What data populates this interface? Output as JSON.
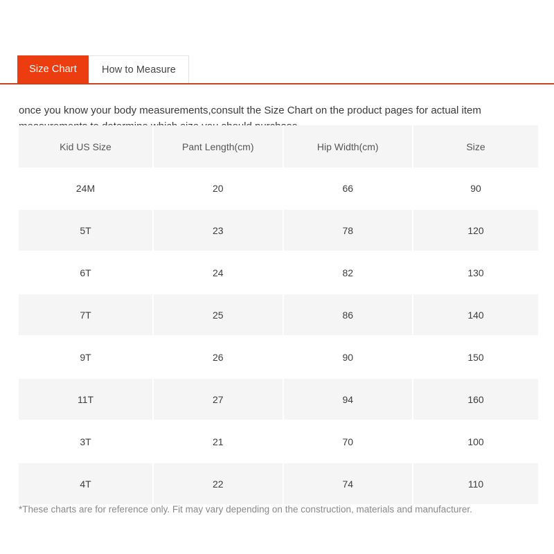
{
  "tabs": [
    {
      "label": "Size Chart",
      "active": true
    },
    {
      "label": "How to Measure",
      "active": false
    }
  ],
  "intro": "once you know your body measurements,consult the Size Chart on the product pages for actual item measurements to determine which size you should purchase.",
  "footnote": "*These charts are for reference only. Fit may vary depending on the construction, materials and manufacturer.",
  "colors": {
    "accent": "#eb3d10",
    "accent_border": "#c8401c",
    "stripe": "#f5f5f5",
    "text": "#3d3d3d",
    "muted": "#888888"
  },
  "chart_data": {
    "type": "table",
    "title": "Size Chart",
    "columns": [
      "Kid US Size",
      "Pant Length(cm)",
      "Hip Width(cm)",
      "Size"
    ],
    "rows": [
      [
        "24M",
        "20",
        "66",
        "90"
      ],
      [
        "5T",
        "23",
        "78",
        "120"
      ],
      [
        "6T",
        "24",
        "82",
        "130"
      ],
      [
        "7T",
        "25",
        "86",
        "140"
      ],
      [
        "9T",
        "26",
        "90",
        "150"
      ],
      [
        "11T",
        "27",
        "94",
        "160"
      ],
      [
        "3T",
        "21",
        "70",
        "100"
      ],
      [
        "4T",
        "22",
        "74",
        "110"
      ]
    ]
  }
}
